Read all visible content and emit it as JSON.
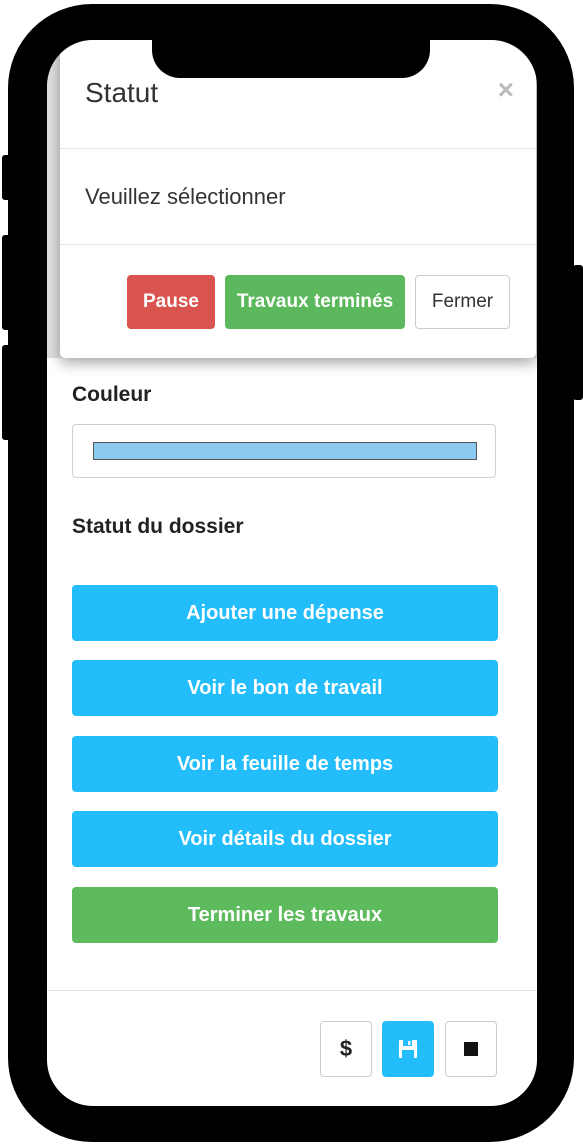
{
  "modal": {
    "title": "Statut",
    "close_glyph": "×",
    "message": "Veuillez sélectionner",
    "buttons": {
      "pause": "Pause",
      "done": "Travaux terminés",
      "close": "Fermer"
    }
  },
  "form": {
    "color_label": "Couleur",
    "color_value": "#8ccaf2",
    "status_label": "Statut du dossier"
  },
  "actions": [
    {
      "label": "Ajouter une dépense",
      "color": "#24bdfb"
    },
    {
      "label": "Voir le bon de travail",
      "color": "#24bdfb"
    },
    {
      "label": "Voir la feuille de temps",
      "color": "#24bdfb"
    },
    {
      "label": "Voir détails du dossier",
      "color": "#24bdfb"
    },
    {
      "label": "Terminer les travaux",
      "color": "#5dbb5d"
    }
  ],
  "footer": {
    "dollar": "$",
    "icons": [
      "dollar-icon",
      "save-icon",
      "stop-icon"
    ]
  },
  "colors": {
    "primary": "#24bdfb",
    "success": "#5dbb5d",
    "danger": "#d9534f"
  }
}
